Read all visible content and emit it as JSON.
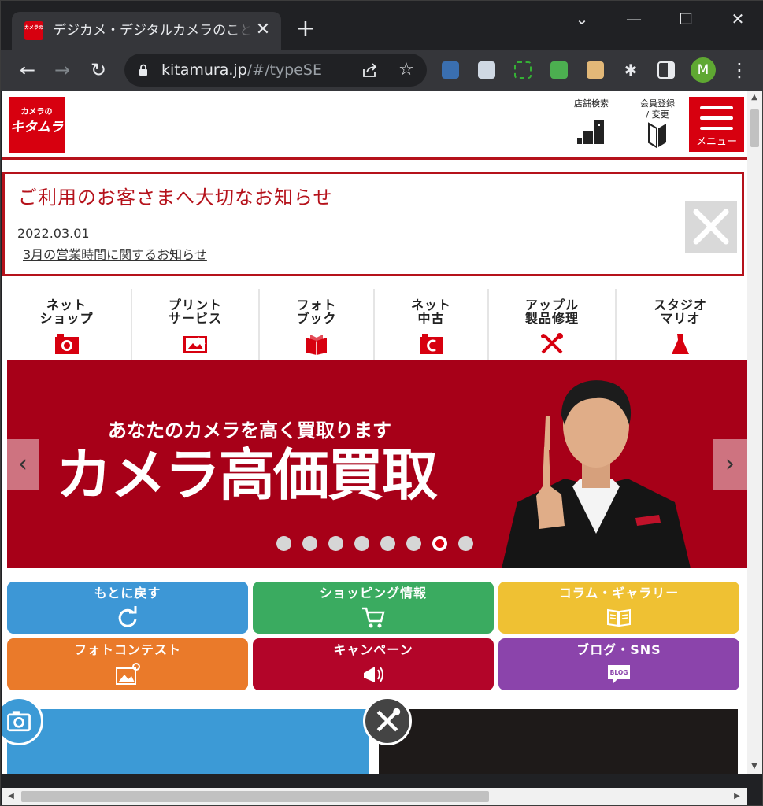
{
  "browser": {
    "tab_title": "デジカメ・デジタルカメラのこと",
    "tab_close": "✕",
    "new_tab": "+",
    "url_host": "kitamura.jp",
    "url_path": "/#/typeSE",
    "profile_initial": "M",
    "window_controls": [
      "⌄",
      "—",
      "☐",
      "✕"
    ]
  },
  "site": {
    "logo_small": "カメラの",
    "logo_large": "キタムラ",
    "favicon_text": "カメラの キタムラ",
    "store_search": "店舗検索",
    "member_line1": "会員登録",
    "member_line2": "/ 変更",
    "menu_label": "メニュー"
  },
  "notice": {
    "title": "ご利用のお客さまへ大切なお知らせ",
    "date": "2022.03.01",
    "link": "3月の営業時間に関するお知らせ"
  },
  "services": [
    {
      "line1": "ネット",
      "line2": "ショップ",
      "icon": "camera-icon"
    },
    {
      "line1": "プリント",
      "line2": "サービス",
      "icon": "photo-print-icon"
    },
    {
      "line1": "フォト",
      "line2": "ブック",
      "icon": "book-icon"
    },
    {
      "line1": "ネット",
      "line2": "中古",
      "icon": "used-camera-icon"
    },
    {
      "line1": "アップル",
      "line2": "製品修理",
      "icon": "repair-tools-icon"
    },
    {
      "line1": "スタジオ",
      "line2": "マリオ",
      "icon": "dress-icon"
    }
  ],
  "hero": {
    "subtitle": "あなたのカメラを高く買取ります",
    "headline": "カメラ高価買取",
    "prev": "‹",
    "next": "›",
    "slide_count": 8,
    "active_slide": 7
  },
  "categories": [
    {
      "label": "もとに戻す",
      "color": "#3d97d6",
      "icon": "refresh-icon"
    },
    {
      "label": "ショッピング情報",
      "color": "#3aab60",
      "icon": "cart-icon"
    },
    {
      "label": "コラム・ギャラリー",
      "color": "#efc133",
      "icon": "open-book-icon"
    },
    {
      "label": "フォトコンテスト",
      "color": "#ea7a2a",
      "icon": "picture-icon"
    },
    {
      "label": "キャンペーン",
      "color": "#b30529",
      "icon": "megaphone-icon"
    },
    {
      "label": "ブログ・SNS",
      "color": "#8b44ab",
      "icon": "blog-icon"
    }
  ],
  "blog_icon_text": "BLOG",
  "colors": {
    "brand_red": "#d7000f",
    "border_red": "#b5121b",
    "hero_red": "#a70018"
  }
}
